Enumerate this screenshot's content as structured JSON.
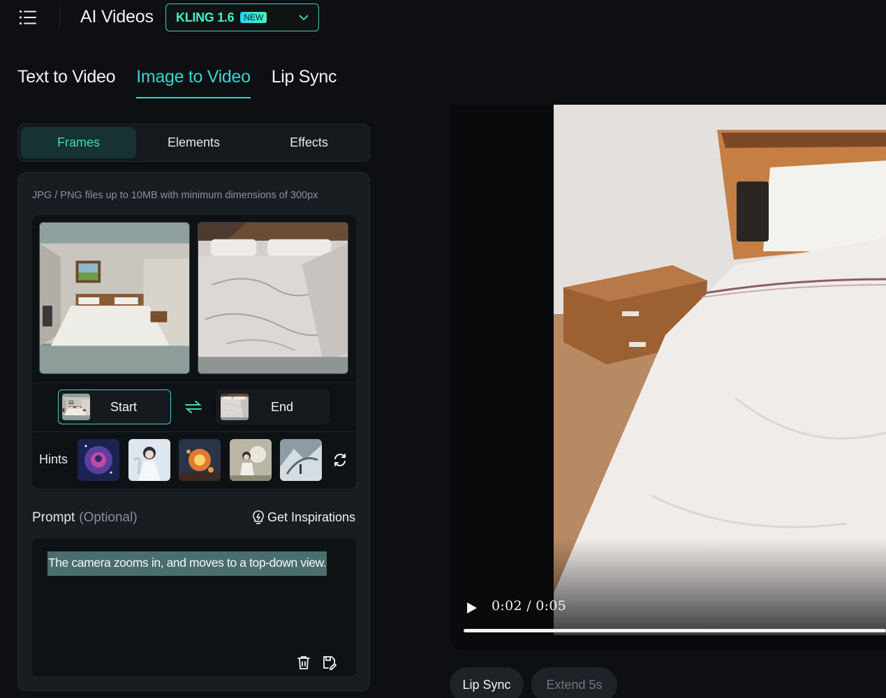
{
  "header": {
    "title": "AI Videos",
    "model": "KLING 1.6",
    "badge": "NEW"
  },
  "main_tabs": [
    {
      "label": "Text to Video"
    },
    {
      "label": "Image to Video"
    },
    {
      "label": "Lip Sync"
    }
  ],
  "sub_tabs": [
    {
      "label": "Frames"
    },
    {
      "label": "Elements"
    },
    {
      "label": "Effects"
    }
  ],
  "upload": {
    "hint": "JPG / PNG files up to 10MB with minimum dimensions of 300px",
    "start_label": "Start",
    "end_label": "End"
  },
  "hints": {
    "label": "Hints"
  },
  "prompt": {
    "label": "Prompt",
    "optional": "(Optional)",
    "inspire": "Get Inspirations",
    "text": "The camera zooms in, and moves to a top-down view."
  },
  "player": {
    "time": "0:02 / 0:05",
    "progress": 1.0
  },
  "actions": {
    "lip_sync": "Lip Sync",
    "extend": "Extend 5s"
  },
  "colors": {
    "accent": "#36d7d0",
    "active_green": "#3fd8b9"
  }
}
